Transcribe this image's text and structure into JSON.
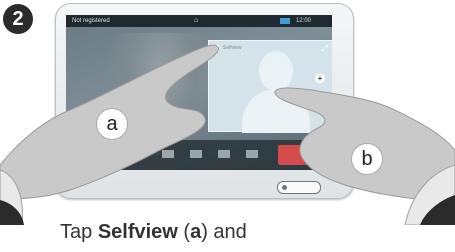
{
  "step_number": "2",
  "device_screen": {
    "status_left": "Not registered",
    "status_right": "12:00",
    "selfview_label": "Selfview"
  },
  "callouts": {
    "a": "a",
    "b": "b"
  },
  "caption": {
    "prefix": "Tap ",
    "bold_1": "Selfview",
    "middle": " (",
    "bold_2": "a",
    "suffix": ") and"
  }
}
